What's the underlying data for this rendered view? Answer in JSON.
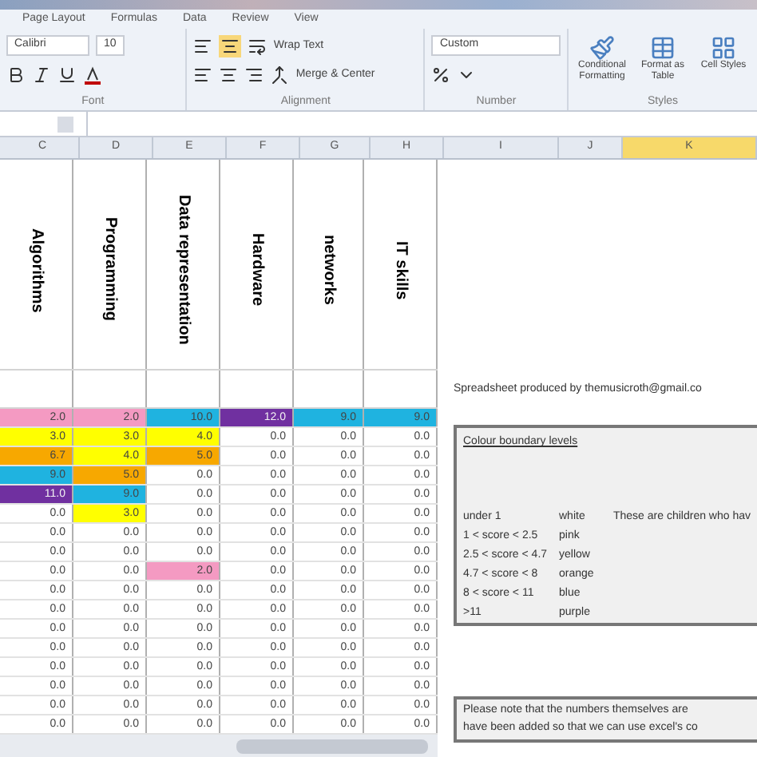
{
  "ribbon": {
    "tabs": [
      "Page Layout",
      "Formulas",
      "Data",
      "Review",
      "View"
    ],
    "font": {
      "name": "Calibri",
      "size": "10"
    },
    "alignment": {
      "wrap": "Wrap Text",
      "merge": "Merge & Center"
    },
    "number": {
      "format": "Custom"
    },
    "styles": [
      "Conditional Formatting",
      "Format as Table",
      "Cell Styles"
    ],
    "groups": [
      "Font",
      "Alignment",
      "Number",
      "Styles"
    ]
  },
  "columns": [
    {
      "label": "C",
      "selected": false
    },
    {
      "label": "D",
      "selected": false
    },
    {
      "label": "E",
      "selected": false
    },
    {
      "label": "F",
      "selected": false
    },
    {
      "label": "G",
      "selected": false
    },
    {
      "label": "H",
      "selected": false
    },
    {
      "label": "I",
      "selected": false
    },
    {
      "label": "J",
      "selected": false
    },
    {
      "label": "K",
      "selected": true
    }
  ],
  "headers": [
    "Algorithms",
    "Programming",
    "Data representation",
    "Hardware",
    "networks",
    "IT skills"
  ],
  "rows": [
    {
      "cells": [
        {
          "value": "2.0",
          "color": "#f49ac2"
        },
        {
          "value": "2.0",
          "color": "#f49ac2"
        },
        {
          "value": "10.0",
          "color": "#1fb3e0"
        },
        {
          "value": "12.0",
          "color": "#7030a0"
        },
        {
          "value": "9.0",
          "color": "#1fb3e0"
        },
        {
          "value": "9.0",
          "color": "#1fb3e0"
        }
      ]
    },
    {
      "cells": [
        {
          "value": "3.0",
          "color": "#ffff00"
        },
        {
          "value": "3.0",
          "color": "#ffff00"
        },
        {
          "value": "4.0",
          "color": "#ffff00"
        },
        {
          "value": "0.0"
        },
        {
          "value": "0.0"
        },
        {
          "value": "0.0"
        }
      ]
    },
    {
      "cells": [
        {
          "value": "6.7",
          "color": "#f7a800"
        },
        {
          "value": "4.0",
          "color": "#ffff00"
        },
        {
          "value": "5.0",
          "color": "#f7a800"
        },
        {
          "value": "0.0"
        },
        {
          "value": "0.0"
        },
        {
          "value": "0.0"
        }
      ]
    },
    {
      "cells": [
        {
          "value": "9.0",
          "color": "#1fb3e0"
        },
        {
          "value": "5.0",
          "color": "#f7a800"
        },
        {
          "value": "0.0"
        },
        {
          "value": "0.0"
        },
        {
          "value": "0.0"
        },
        {
          "value": "0.0"
        }
      ]
    },
    {
      "cells": [
        {
          "value": "11.0",
          "color": "#7030a0"
        },
        {
          "value": "9.0",
          "color": "#1fb3e0"
        },
        {
          "value": "0.0"
        },
        {
          "value": "0.0"
        },
        {
          "value": "0.0"
        },
        {
          "value": "0.0"
        }
      ]
    },
    {
      "cells": [
        {
          "value": "0.0"
        },
        {
          "value": "3.0",
          "color": "#ffff00"
        },
        {
          "value": "0.0"
        },
        {
          "value": "0.0"
        },
        {
          "value": "0.0"
        },
        {
          "value": "0.0"
        }
      ]
    },
    {
      "cells": [
        {
          "value": "0.0"
        },
        {
          "value": "0.0"
        },
        {
          "value": "0.0"
        },
        {
          "value": "0.0"
        },
        {
          "value": "0.0"
        },
        {
          "value": "0.0"
        }
      ]
    },
    {
      "cells": [
        {
          "value": "0.0"
        },
        {
          "value": "0.0"
        },
        {
          "value": "0.0"
        },
        {
          "value": "0.0"
        },
        {
          "value": "0.0"
        },
        {
          "value": "0.0"
        }
      ]
    },
    {
      "cells": [
        {
          "value": "0.0"
        },
        {
          "value": "0.0"
        },
        {
          "value": "2.0",
          "color": "#f49ac2"
        },
        {
          "value": "0.0"
        },
        {
          "value": "0.0"
        },
        {
          "value": "0.0"
        }
      ]
    },
    {
      "cells": [
        {
          "value": "0.0"
        },
        {
          "value": "0.0"
        },
        {
          "value": "0.0"
        },
        {
          "value": "0.0"
        },
        {
          "value": "0.0"
        },
        {
          "value": "0.0"
        }
      ]
    },
    {
      "cells": [
        {
          "value": "0.0"
        },
        {
          "value": "0.0"
        },
        {
          "value": "0.0"
        },
        {
          "value": "0.0"
        },
        {
          "value": "0.0"
        },
        {
          "value": "0.0"
        }
      ]
    },
    {
      "cells": [
        {
          "value": "0.0"
        },
        {
          "value": "0.0"
        },
        {
          "value": "0.0"
        },
        {
          "value": "0.0"
        },
        {
          "value": "0.0"
        },
        {
          "value": "0.0"
        }
      ]
    },
    {
      "cells": [
        {
          "value": "0.0"
        },
        {
          "value": "0.0"
        },
        {
          "value": "0.0"
        },
        {
          "value": "0.0"
        },
        {
          "value": "0.0"
        },
        {
          "value": "0.0"
        }
      ]
    },
    {
      "cells": [
        {
          "value": "0.0"
        },
        {
          "value": "0.0"
        },
        {
          "value": "0.0"
        },
        {
          "value": "0.0"
        },
        {
          "value": "0.0"
        },
        {
          "value": "0.0"
        }
      ]
    },
    {
      "cells": [
        {
          "value": "0.0"
        },
        {
          "value": "0.0"
        },
        {
          "value": "0.0"
        },
        {
          "value": "0.0"
        },
        {
          "value": "0.0"
        },
        {
          "value": "0.0"
        }
      ]
    },
    {
      "cells": [
        {
          "value": "0.0"
        },
        {
          "value": "0.0"
        },
        {
          "value": "0.0"
        },
        {
          "value": "0.0"
        },
        {
          "value": "0.0"
        },
        {
          "value": "0.0"
        }
      ]
    },
    {
      "cells": [
        {
          "value": "0.0"
        },
        {
          "value": "0.0"
        },
        {
          "value": "0.0"
        },
        {
          "value": "0.0"
        },
        {
          "value": "0.0"
        },
        {
          "value": "0.0"
        }
      ]
    }
  ],
  "credit": "Spreadsheet produced by themusicroth@gmail.co",
  "legend": {
    "title": "Colour boundary levels",
    "items": [
      {
        "range": "under 1",
        "colour": "white",
        "note": "These are children who hav"
      },
      {
        "range": "1 < score < 2.5",
        "colour": "pink"
      },
      {
        "range": "2.5 < score < 4.7",
        "colour": "yellow"
      },
      {
        "range": "4.7 < score < 8",
        "colour": "orange"
      },
      {
        "range": "8 < score < 11",
        "colour": "blue"
      },
      {
        "range": ">11",
        "colour": "purple"
      }
    ]
  },
  "note": [
    "Please note that the numbers themselves are",
    "have been added so that we can use excel's co"
  ]
}
